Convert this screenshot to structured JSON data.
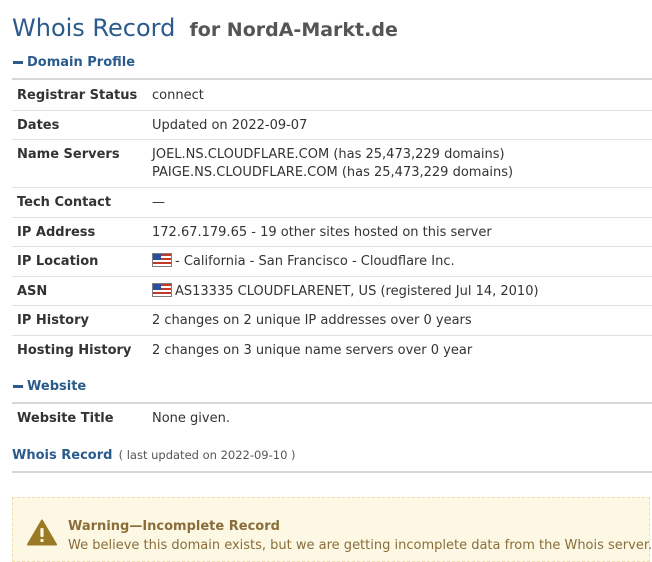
{
  "header": {
    "title_main": "Whois Record",
    "title_sub": "for NordA-Markt.de"
  },
  "sections": {
    "domain_profile": "Domain Profile",
    "website": "Website"
  },
  "profile": {
    "registrar_status": {
      "label": "Registrar Status",
      "value": "connect"
    },
    "dates": {
      "label": "Dates",
      "value": "Updated on 2022-09-07"
    },
    "name_servers": {
      "label": "Name Servers",
      "ns1": "JOEL.NS.CLOUDFLARE.COM (has 25,473,229 domains)",
      "ns2": "PAIGE.NS.CLOUDFLARE.COM (has 25,473,229 domains)"
    },
    "tech_contact": {
      "label": "Tech Contact",
      "value": "—"
    },
    "ip_address": {
      "label": "IP Address",
      "value": "172.67.179.65 - 19 other sites hosted on this server"
    },
    "ip_location": {
      "label": "IP Location",
      "value": "- California - San Francisco - Cloudflare Inc.",
      "flag": "us-flag-icon"
    },
    "asn": {
      "label": "ASN",
      "value": "AS13335 CLOUDFLARENET, US (registered Jul 14, 2010)",
      "flag": "us-flag-icon"
    },
    "ip_history": {
      "label": "IP History",
      "value": "2 changes on 2 unique IP addresses over 0 years"
    },
    "hosting_history": {
      "label": "Hosting History",
      "value": "2 changes on 3 unique name servers over 0 year"
    }
  },
  "website": {
    "title": {
      "label": "Website Title",
      "value": "None given."
    }
  },
  "whois_record": {
    "link": "Whois Record",
    "updated": "( last updated on 2022-09-10 )"
  },
  "warning": {
    "icon": "warning-triangle-icon",
    "title": "Warning—Incomplete Record",
    "message": "We believe this domain exists, but we are getting incomplete data from the Whois server."
  },
  "colors": {
    "accent": "#2b5a8c",
    "warning_bg": "#fcf8e3",
    "warning_text": "#8a6d3b",
    "warning_icon": "#9b7a26"
  }
}
